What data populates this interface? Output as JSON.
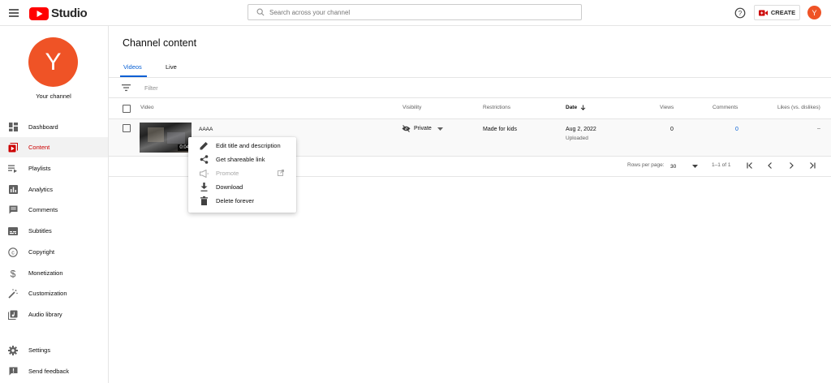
{
  "app": {
    "logo_text": "Studio",
    "brand_color": "#ff0000",
    "accent_color": "#065fd4",
    "avatar_letter": "Y",
    "avatar_color": "#ef5326"
  },
  "search": {
    "placeholder": "Search across your channel"
  },
  "header": {
    "create_label": "CREATE"
  },
  "sidebar": {
    "channel_label": "Your channel",
    "items": [
      {
        "label": "Dashboard",
        "icon": "dashboard-icon"
      },
      {
        "label": "Content",
        "icon": "content-icon",
        "active": true
      },
      {
        "label": "Playlists",
        "icon": "playlist-icon"
      },
      {
        "label": "Analytics",
        "icon": "analytics-icon"
      },
      {
        "label": "Comments",
        "icon": "comments-icon"
      },
      {
        "label": "Subtitles",
        "icon": "subtitles-icon"
      },
      {
        "label": "Copyright",
        "icon": "copyright-icon"
      },
      {
        "label": "Monetization",
        "icon": "dollar-icon"
      },
      {
        "label": "Customization",
        "icon": "magic-wand-icon"
      },
      {
        "label": "Audio library",
        "icon": "audio-library-icon"
      },
      {
        "label": "Settings",
        "icon": "gear-icon"
      },
      {
        "label": "Send feedback",
        "icon": "feedback-icon"
      }
    ]
  },
  "main": {
    "title": "Channel content",
    "tabs": [
      {
        "label": "Videos",
        "active": true
      },
      {
        "label": "Live"
      }
    ],
    "filter_placeholder": "Filter"
  },
  "table": {
    "columns": [
      "Video",
      "Visibility",
      "Restrictions",
      "Date",
      "Views",
      "Comments",
      "Likes (vs. dislikes)"
    ],
    "rows": [
      {
        "title": "AAAA",
        "duration": "0:04",
        "visibility": "Private",
        "restrictions": "Made for kids",
        "date": "Aug 2, 2022",
        "date_status": "Uploaded",
        "views": "0",
        "comments": "0",
        "likes": "–"
      }
    ]
  },
  "pagination": {
    "rows_per_page_label": "Rows per page:",
    "rows_per_page_value": "30",
    "range": "1–1 of 1"
  },
  "context_menu": {
    "items": [
      {
        "label": "Edit title and description",
        "icon": "pencil-icon"
      },
      {
        "label": "Get shareable link",
        "icon": "share-icon"
      },
      {
        "label": "Promote",
        "icon": "megaphone-icon",
        "disabled": true
      },
      {
        "label": "Download",
        "icon": "download-icon"
      },
      {
        "label": "Delete forever",
        "icon": "trash-icon"
      }
    ]
  }
}
